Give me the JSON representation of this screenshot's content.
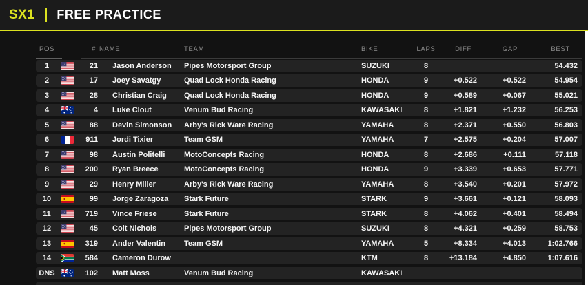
{
  "topbar": {
    "series": "SX1",
    "session": "FREE PRACTICE"
  },
  "colors": {
    "accent": "#dbe120",
    "panel_bg": "#121212",
    "row_bg": "#232323",
    "topbar_bg": "#1b1b1b"
  },
  "table": {
    "columns": {
      "pos": "POS",
      "num": "#",
      "name": "NAME",
      "team": "TEAM",
      "bike": "BIKE",
      "laps": "LAPS",
      "diff": "DIFF",
      "gap": "GAP",
      "best": "BEST"
    },
    "rows": [
      {
        "pos": "1",
        "flag": "us",
        "num": "21",
        "name": "Jason Anderson",
        "team": "Pipes Motorsport Group",
        "bike": "SUZUKI",
        "laps": "8",
        "diff": "",
        "gap": "",
        "best": "54.432"
      },
      {
        "pos": "2",
        "flag": "us",
        "num": "17",
        "name": "Joey Savatgy",
        "team": "Quad Lock Honda Racing",
        "bike": "HONDA",
        "laps": "9",
        "diff": "+0.522",
        "gap": "+0.522",
        "best": "54.954"
      },
      {
        "pos": "3",
        "flag": "us",
        "num": "28",
        "name": "Christian Craig",
        "team": "Quad Lock Honda Racing",
        "bike": "HONDA",
        "laps": "9",
        "diff": "+0.589",
        "gap": "+0.067",
        "best": "55.021"
      },
      {
        "pos": "4",
        "flag": "au",
        "num": "4",
        "name": "Luke Clout",
        "team": "Venum Bud Racing",
        "bike": "KAWASAKI",
        "laps": "8",
        "diff": "+1.821",
        "gap": "+1.232",
        "best": "56.253"
      },
      {
        "pos": "5",
        "flag": "us",
        "num": "88",
        "name": "Devin Simonson",
        "team": "Arby's Rick Ware Racing",
        "bike": "YAMAHA",
        "laps": "8",
        "diff": "+2.371",
        "gap": "+0.550",
        "best": "56.803"
      },
      {
        "pos": "6",
        "flag": "fr",
        "num": "911",
        "name": "Jordi Tixier",
        "team": "Team GSM",
        "bike": "YAMAHA",
        "laps": "7",
        "diff": "+2.575",
        "gap": "+0.204",
        "best": "57.007"
      },
      {
        "pos": "7",
        "flag": "us",
        "num": "98",
        "name": "Austin Politelli",
        "team": "MotoConcepts Racing",
        "bike": "HONDA",
        "laps": "8",
        "diff": "+2.686",
        "gap": "+0.111",
        "best": "57.118"
      },
      {
        "pos": "8",
        "flag": "us",
        "num": "200",
        "name": "Ryan Breece",
        "team": "MotoConcepts Racing",
        "bike": "HONDA",
        "laps": "9",
        "diff": "+3.339",
        "gap": "+0.653",
        "best": "57.771"
      },
      {
        "pos": "9",
        "flag": "us",
        "num": "29",
        "name": "Henry Miller",
        "team": "Arby's Rick Ware Racing",
        "bike": "YAMAHA",
        "laps": "8",
        "diff": "+3.540",
        "gap": "+0.201",
        "best": "57.972"
      },
      {
        "pos": "10",
        "flag": "es",
        "num": "99",
        "name": "Jorge Zaragoza",
        "team": "Stark Future",
        "bike": "STARK",
        "laps": "9",
        "diff": "+3.661",
        "gap": "+0.121",
        "best": "58.093"
      },
      {
        "pos": "11",
        "flag": "us",
        "num": "719",
        "name": "Vince Friese",
        "team": "Stark Future",
        "bike": "STARK",
        "laps": "8",
        "diff": "+4.062",
        "gap": "+0.401",
        "best": "58.494"
      },
      {
        "pos": "12",
        "flag": "us",
        "num": "45",
        "name": "Colt Nichols",
        "team": "Pipes Motorsport Group",
        "bike": "SUZUKI",
        "laps": "8",
        "diff": "+4.321",
        "gap": "+0.259",
        "best": "58.753"
      },
      {
        "pos": "13",
        "flag": "es",
        "num": "319",
        "name": "Ander Valentin",
        "team": "Team GSM",
        "bike": "YAMAHA",
        "laps": "5",
        "diff": "+8.334",
        "gap": "+4.013",
        "best": "1:02.766"
      },
      {
        "pos": "14",
        "flag": "za",
        "num": "584",
        "name": "Cameron Durow",
        "team": "",
        "bike": "KTM",
        "laps": "8",
        "diff": "+13.184",
        "gap": "+4.850",
        "best": "1:07.616"
      },
      {
        "pos": "DNS",
        "flag": "au",
        "num": "102",
        "name": "Matt Moss",
        "team": "Venum Bud Racing",
        "bike": "KAWASAKI",
        "laps": "",
        "diff": "",
        "gap": "",
        "best": ""
      }
    ]
  }
}
